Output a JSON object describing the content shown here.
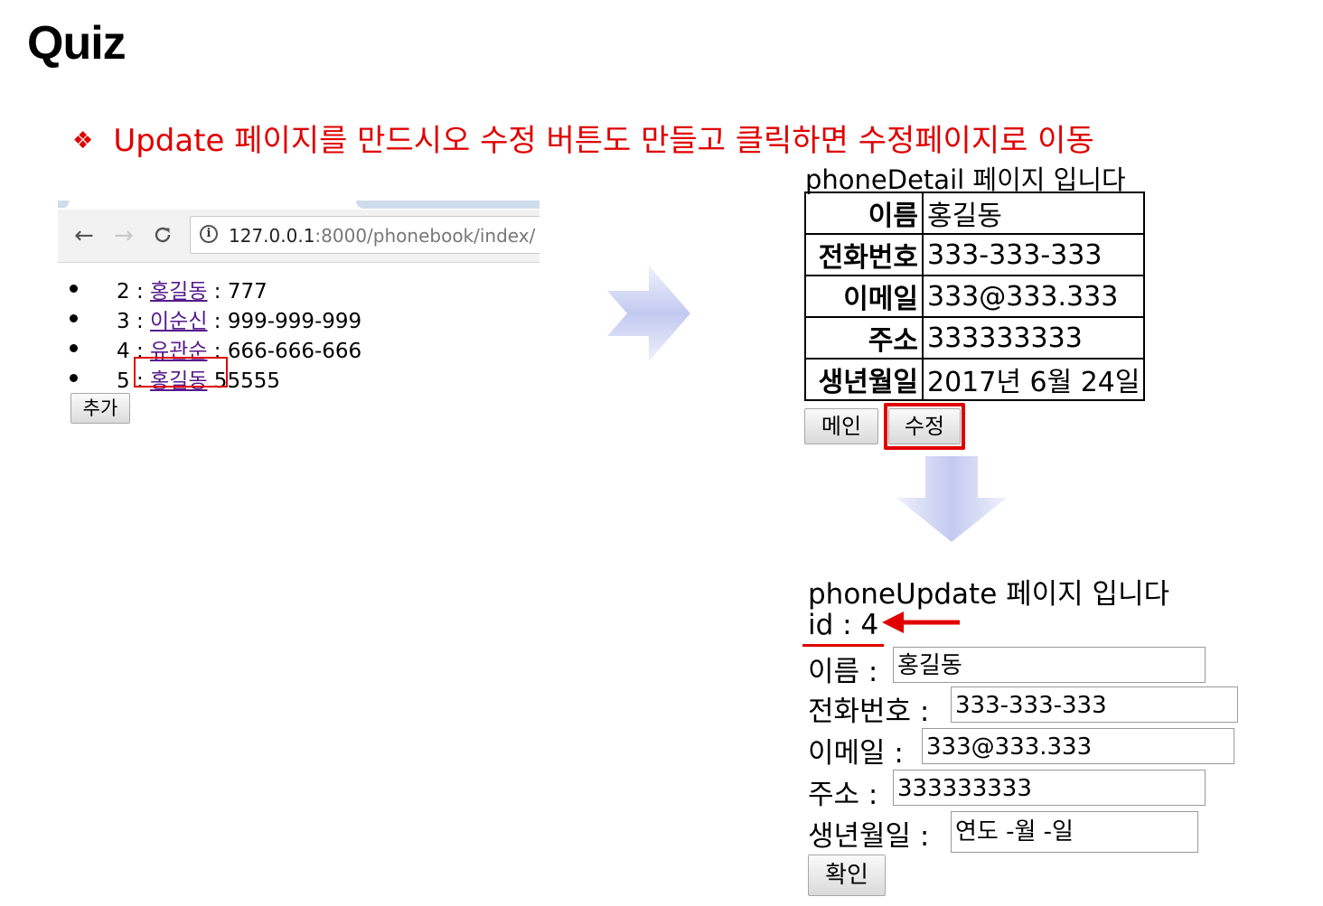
{
  "slide": {
    "title": "Quiz",
    "instruction_bullet": "❖",
    "instruction": "Update 페이지를 만드시오 수정 버튼도 만들고 클릭하면 수정페이지로 이동"
  },
  "browser": {
    "nav": {
      "back": "←",
      "forward": "→",
      "reload": "C"
    },
    "url_host": "127.0.0.1",
    "url_rest": ":8000/phonebook/index/",
    "list": [
      {
        "id": "2",
        "sep": " : ",
        "name": "홍길동",
        "tail": " : 777"
      },
      {
        "id": "3",
        "sep": " : ",
        "name": "이순신",
        "tail": " : 999-999-999"
      },
      {
        "id": "4",
        "sep": " : ",
        "name": "유관순",
        "tail": " : 666-666-666"
      },
      {
        "id": "5",
        "sep": " : ",
        "name": "홍길동",
        "tail": "  55555"
      }
    ],
    "add_button": "추가"
  },
  "detail": {
    "title": "phoneDetail 페이지 입니다",
    "rows": [
      {
        "label": "이름",
        "value": "홍길동"
      },
      {
        "label": "전화번호",
        "value": "333-333-333"
      },
      {
        "label": "이메일",
        "value": "333@333.333"
      },
      {
        "label": "주소",
        "value": "333333333"
      },
      {
        "label": "생년월일",
        "value": "2017년 6월 24일"
      }
    ],
    "main_button": "메인",
    "edit_button": "수정"
  },
  "update": {
    "title": "phoneUpdate 페이지 입니다",
    "id_line": "id : 4",
    "fields": [
      {
        "label": "이름 :",
        "value": "홍길동"
      },
      {
        "label": "전화번호 :",
        "value": "333-333-333"
      },
      {
        "label": "이메일 :",
        "value": "333@333.333"
      },
      {
        "label": "주소 :",
        "value": "333333333"
      },
      {
        "label": "생년월일 :",
        "value": "연도 -월 -일"
      }
    ],
    "confirm_button": "확인"
  },
  "colors": {
    "instruction": "#e00000",
    "highlight": "#e00000",
    "link": "#551a8b",
    "arrow_light": "#e8ecfa",
    "arrow_dark": "#bcc4ee"
  }
}
